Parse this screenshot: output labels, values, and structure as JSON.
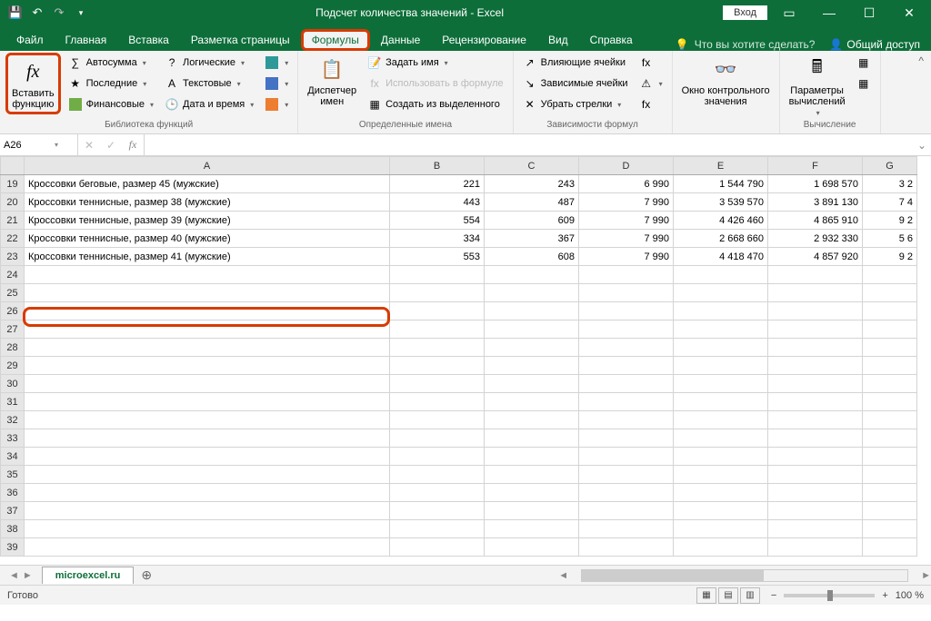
{
  "titlebar": {
    "title": "Подсчет количества значений  -  Excel",
    "signin": "Вход"
  },
  "tabs": {
    "file": "Файл",
    "home": "Главная",
    "insert": "Вставка",
    "layout": "Разметка страницы",
    "formulas": "Формулы",
    "data": "Данные",
    "review": "Рецензирование",
    "view": "Вид",
    "help": "Справка",
    "tellme": "Что вы хотите сделать?",
    "share": "Общий доступ"
  },
  "ribbon": {
    "insert_fn": "Вставить\nфункцию",
    "autosum": "Автосумма",
    "recent": "Последние",
    "financial": "Финансовые",
    "logical": "Логические",
    "text": "Текстовые",
    "datetime": "Дата и время",
    "group_lib": "Библиотека функций",
    "name_mgr": "Диспетчер\nимен",
    "define_name": "Задать имя",
    "use_in_formula": "Использовать в формуле",
    "create_from_sel": "Создать из выделенного",
    "group_names": "Определенные имена",
    "trace_prec": "Влияющие ячейки",
    "trace_dep": "Зависимые ячейки",
    "remove_arrows": "Убрать стрелки",
    "group_audit": "Зависимости формул",
    "watch": "Окно контрольного\nзначения",
    "calc_opts": "Параметры\nвычислений",
    "group_calc": "Вычисление"
  },
  "namebox": {
    "value": "A26"
  },
  "columns": [
    "A",
    "B",
    "C",
    "D",
    "E",
    "F",
    "G"
  ],
  "rows": [
    {
      "n": "19",
      "a": "Кроссовки беговые, размер 45 (мужские)",
      "b": "221",
      "c": "243",
      "d": "6 990",
      "e": "1 544 790",
      "f": "1 698 570",
      "g": "3 2"
    },
    {
      "n": "20",
      "a": "Кроссовки теннисные, размер 38 (мужские)",
      "b": "443",
      "c": "487",
      "d": "7 990",
      "e": "3 539 570",
      "f": "3 891 130",
      "g": "7 4"
    },
    {
      "n": "21",
      "a": "Кроссовки теннисные, размер 39 (мужские)",
      "b": "554",
      "c": "609",
      "d": "7 990",
      "e": "4 426 460",
      "f": "4 865 910",
      "g": "9 2"
    },
    {
      "n": "22",
      "a": "Кроссовки теннисные, размер 40 (мужские)",
      "b": "334",
      "c": "367",
      "d": "7 990",
      "e": "2 668 660",
      "f": "2 932 330",
      "g": "5 6"
    },
    {
      "n": "23",
      "a": "Кроссовки теннисные, размер 41 (мужские)",
      "b": "553",
      "c": "608",
      "d": "7 990",
      "e": "4 418 470",
      "f": "4 857 920",
      "g": "9 2"
    }
  ],
  "empty_rows": [
    "24",
    "25",
    "26",
    "27",
    "28",
    "29",
    "30",
    "31",
    "32",
    "33",
    "34",
    "35",
    "36",
    "37",
    "38",
    "39"
  ],
  "sheet": {
    "name": "microexcel.ru"
  },
  "status": {
    "ready": "Готово",
    "zoom": "100 %"
  }
}
